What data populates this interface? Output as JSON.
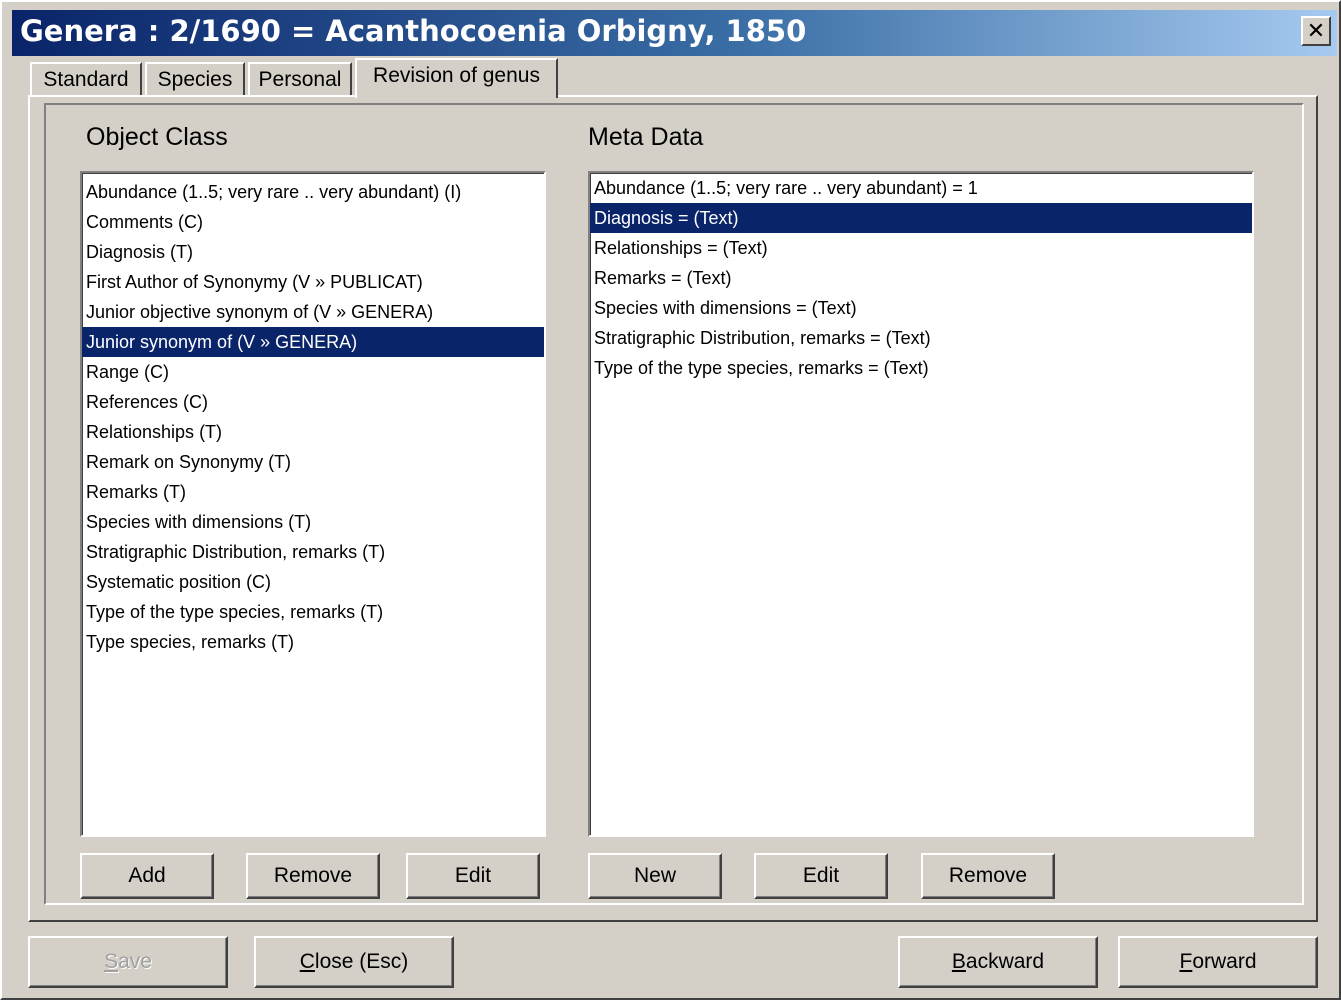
{
  "window": {
    "title": "Genera : 2/1690 = Acanthocoenia Orbigny, 1850",
    "close_glyph": "✕"
  },
  "tabs": [
    {
      "label": "Standard",
      "active": false
    },
    {
      "label": "Species",
      "active": false
    },
    {
      "label": "Personal",
      "active": false
    },
    {
      "label": "Revision of genus",
      "active": true
    }
  ],
  "object_class": {
    "title": "Object Class",
    "items": [
      "Abundance (1..5; very rare .. very abundant) (I)",
      "Comments (C)",
      "Diagnosis (T)",
      "First Author of Synonymy (V » PUBLICAT)",
      "Junior objective synonym of (V » GENERA)",
      "Junior synonym of (V » GENERA)",
      "Range (C)",
      "References (C)",
      "Relationships (T)",
      "Remark on Synonymy (T)",
      "Remarks (T)",
      "Species with dimensions (T)",
      "Stratigraphic Distribution, remarks (T)",
      "Systematic position (C)",
      "Type of the type species, remarks (T)",
      "Type species, remarks (T)"
    ],
    "selected_index": 5,
    "buttons": {
      "add": "Add",
      "remove": "Remove",
      "edit": "Edit"
    }
  },
  "meta_data": {
    "title": "Meta Data",
    "items": [
      "Abundance (1..5; very rare .. very abundant) = 1",
      "Diagnosis =  (Text)",
      "Relationships =  (Text)",
      "Remarks =  (Text)",
      "Species with dimensions =  (Text)",
      "Stratigraphic Distribution, remarks =  (Text)",
      "Type of the type species, remarks =  (Text)"
    ],
    "selected_index": 1,
    "buttons": {
      "new": "New",
      "edit": "Edit",
      "remove": "Remove"
    }
  },
  "footer": {
    "save": {
      "label": "Save",
      "mnemonic": "S",
      "rest": "ave",
      "enabled": false
    },
    "close": {
      "label": "Close (Esc)",
      "mnemonic": "C",
      "rest": "lose (Esc)"
    },
    "backward": {
      "label": "Backward",
      "mnemonic": "B",
      "rest": "ackward"
    },
    "forward": {
      "label": "Forward",
      "mnemonic": "F",
      "rest": "orward"
    }
  }
}
